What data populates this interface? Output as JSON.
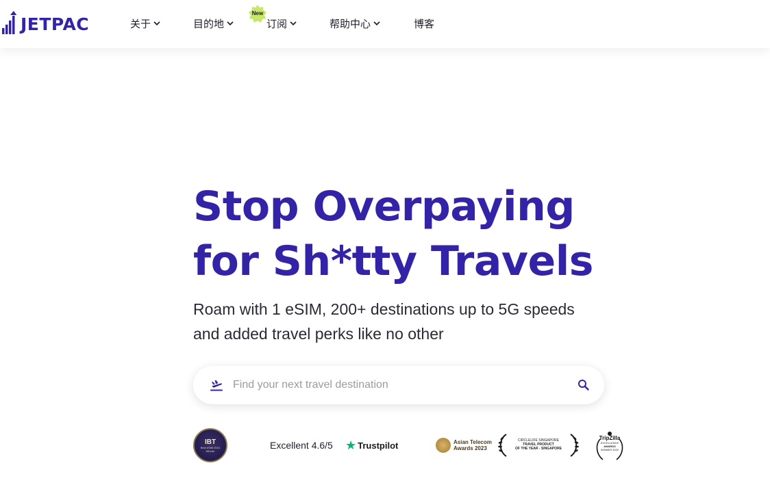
{
  "header": {
    "logo_text": "JETPAC",
    "nav": [
      {
        "label": "关于",
        "has_dropdown": true
      },
      {
        "label": "目的地",
        "has_dropdown": true
      },
      {
        "label": "订阅",
        "has_dropdown": true,
        "badge": "New"
      },
      {
        "label": "帮助中心",
        "has_dropdown": true
      },
      {
        "label": "博客",
        "has_dropdown": false
      }
    ]
  },
  "hero": {
    "title_line1": "Stop Overpaying",
    "title_line2": "for Sh*tty Travels",
    "subtitle_line1": "Roam with 1 eSIM, 200+ destinations up to 5G speeds",
    "subtitle_line2": "and added travel perks like no other"
  },
  "search": {
    "placeholder": "Find your next travel destination",
    "value": "",
    "left_icon": "plane-departure-icon",
    "right_icon": "search-icon"
  },
  "badges": {
    "ibt": {
      "title": "IBT",
      "sub": "Best eSIM 2024",
      "sub2": "Winner"
    },
    "rating_text": "Excellent 4.6/5",
    "trustpilot": "Trustpilot",
    "asian_telecom": {
      "line1": "Asian Telecom",
      "line2": "Awards 2023"
    },
    "circle_award": {
      "line1": "CIRCLELIFE SINGAPORE",
      "line2": "TRAVEL PRODUCT",
      "line3": "OF THE YEAR - SINGAPORE"
    },
    "tripzilla": {
      "line1": "TripZilla",
      "line2": "EXCELLENCE",
      "line3": "AWARDS",
      "line4": "WINNER 2022"
    }
  },
  "colors": {
    "brand": "#3323a6",
    "text": "#1f1f2e",
    "badge_green": "#c6e86a",
    "trustpilot_green": "#00b67a"
  }
}
